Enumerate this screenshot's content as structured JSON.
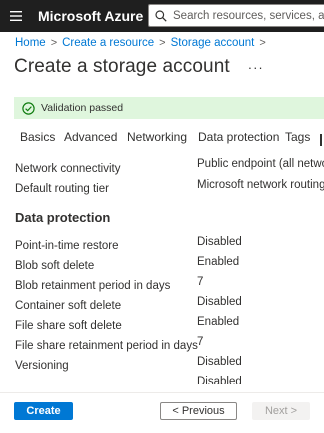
{
  "topbar": {
    "brand": "Microsoft Azure",
    "search_placeholder": "Search resources, services, and docs (G+/)",
    "background": "#1f1f1f",
    "icons": [
      "hamburger-menu-icon",
      "search-icon"
    ]
  },
  "breadcrumb": {
    "items": [
      "Home",
      "Create a resource",
      "Storage account"
    ]
  },
  "page": {
    "title": "Create a storage account",
    "more": "···"
  },
  "validation": {
    "text": "Validation passed",
    "icon": "check-circle-icon",
    "color": "#107c10",
    "background": "#dff6dd"
  },
  "tabs": [
    "Basics",
    "Advanced",
    "Networking",
    "Data protection",
    "Tags"
  ],
  "summary": {
    "network": [
      {
        "label": "Network connectivity",
        "value": "Public endpoint (all networks)"
      },
      {
        "label": "Default routing tier",
        "value": "Microsoft network routing"
      }
    ],
    "data_protection": {
      "title": "Data protection",
      "rows": [
        {
          "label": "Point-in-time restore",
          "value": "Disabled"
        },
        {
          "label": "Blob soft delete",
          "value": "Enabled"
        },
        {
          "label": "Blob retainment period in days",
          "value": "7"
        },
        {
          "label": "Container soft delete",
          "value": "Disabled"
        },
        {
          "label": "File share soft delete",
          "value": "Enabled"
        },
        {
          "label": "File share retainment period in days",
          "value": "7"
        },
        {
          "label": "Versioning",
          "value": "Disabled"
        },
        {
          "label": "",
          "value": "Disabled"
        }
      ]
    }
  },
  "footer": {
    "create": "Create",
    "previous": "< Previous",
    "next": "Next >",
    "accent": "#0078d4"
  }
}
